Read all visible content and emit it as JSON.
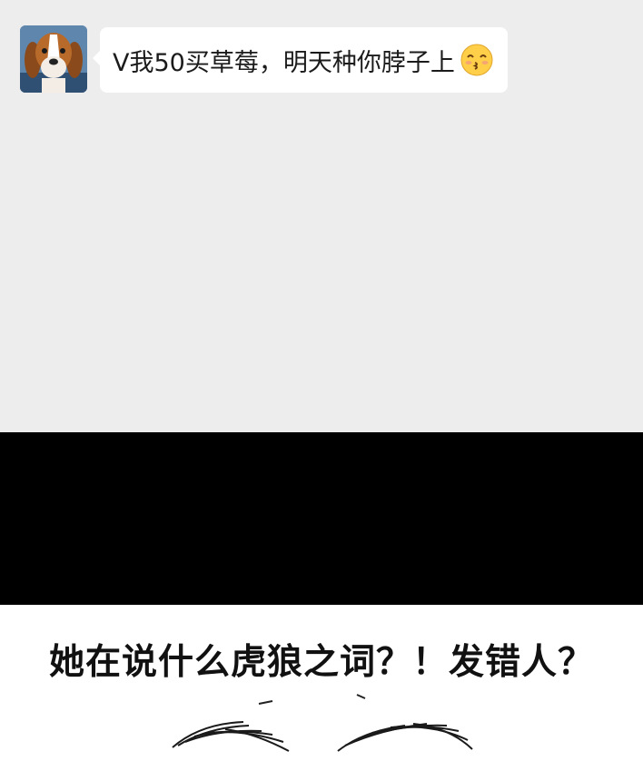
{
  "chat": {
    "message": "V我50买草莓，明天种你脖子上",
    "emoji_icon": "kissing-face-emoji-icon"
  },
  "comic": {
    "caption": "她在说什么虎狼之词？！发错人？"
  },
  "colors": {
    "chat_background": "#ededed",
    "bubble_background": "#ffffff",
    "panel_black": "#000000"
  }
}
